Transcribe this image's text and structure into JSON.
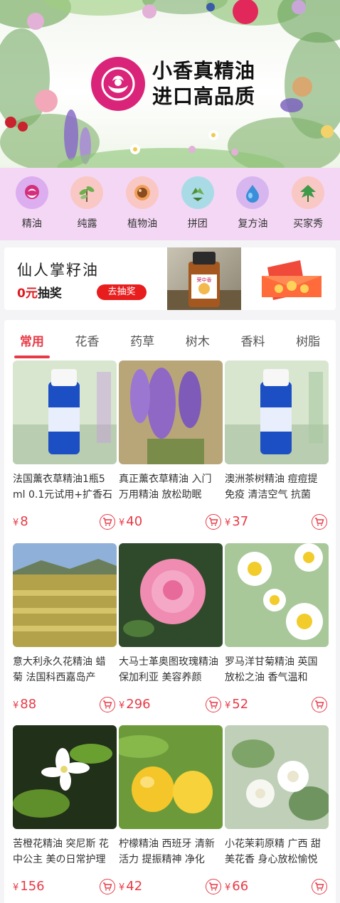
{
  "banner": {
    "brand_line1": "小香真精油",
    "brand_line2": "进口高品质"
  },
  "categories": [
    {
      "label": "精油",
      "icon": "rose-icon",
      "bg": "#dcaef0"
    },
    {
      "label": "纯露",
      "icon": "sprout-icon",
      "bg": "#f9c8c4"
    },
    {
      "label": "植物油",
      "icon": "seed-icon",
      "bg": "#f9c8c4"
    },
    {
      "label": "拼团",
      "icon": "recycle-leaf-icon",
      "bg": "#a9dbe6"
    },
    {
      "label": "复方油",
      "icon": "drop-icon",
      "bg": "#d7b6ef"
    },
    {
      "label": "买家秀",
      "icon": "leaf-icon",
      "bg": "#f9c8c4"
    }
  ],
  "promo": {
    "title": "仙人掌籽油",
    "sub_prefix": "0元",
    "sub_suffix": "抽奖",
    "button": "去抽奖",
    "label_bottle": "荣中香"
  },
  "tabs": [
    "常用",
    "花香",
    "药草",
    "树木",
    "香料",
    "树脂"
  ],
  "active_tab": "常用",
  "currency": "¥",
  "products": [
    {
      "title": "法国薰衣草精油1瓶5ml 0.1元试用+扩香石",
      "price": "8",
      "image": "blue-bottle-lavender"
    },
    {
      "title": "真正薰衣草精油 入门万用精油 放松助眠",
      "price": "40",
      "image": "lavender-flower"
    },
    {
      "title": "澳洲茶树精油 痘痘提免疫 清洁空气 抗菌",
      "price": "37",
      "image": "blue-bottle-teatree"
    },
    {
      "title": "意大利永久花精油 蜡菊 法国科西嘉岛产",
      "price": "88",
      "image": "helichrysum-field"
    },
    {
      "title": "大马士革奥图玫瑰精油 保加利亚 美容养颜",
      "price": "296",
      "image": "pink-rose"
    },
    {
      "title": "罗马洋甘菊精油 英国 放松之油 香气温和",
      "price": "52",
      "image": "chamomile"
    },
    {
      "title": "苦橙花精油 突尼斯 花中公主 美の日常护理",
      "price": "156",
      "image": "neroli-blossom"
    },
    {
      "title": "柠檬精油 西班牙 清新活力 提振精神 净化",
      "price": "42",
      "image": "lemon"
    },
    {
      "title": "小花茉莉原精 广西 甜美花香 身心放松愉悦",
      "price": "66",
      "image": "jasmine"
    }
  ]
}
